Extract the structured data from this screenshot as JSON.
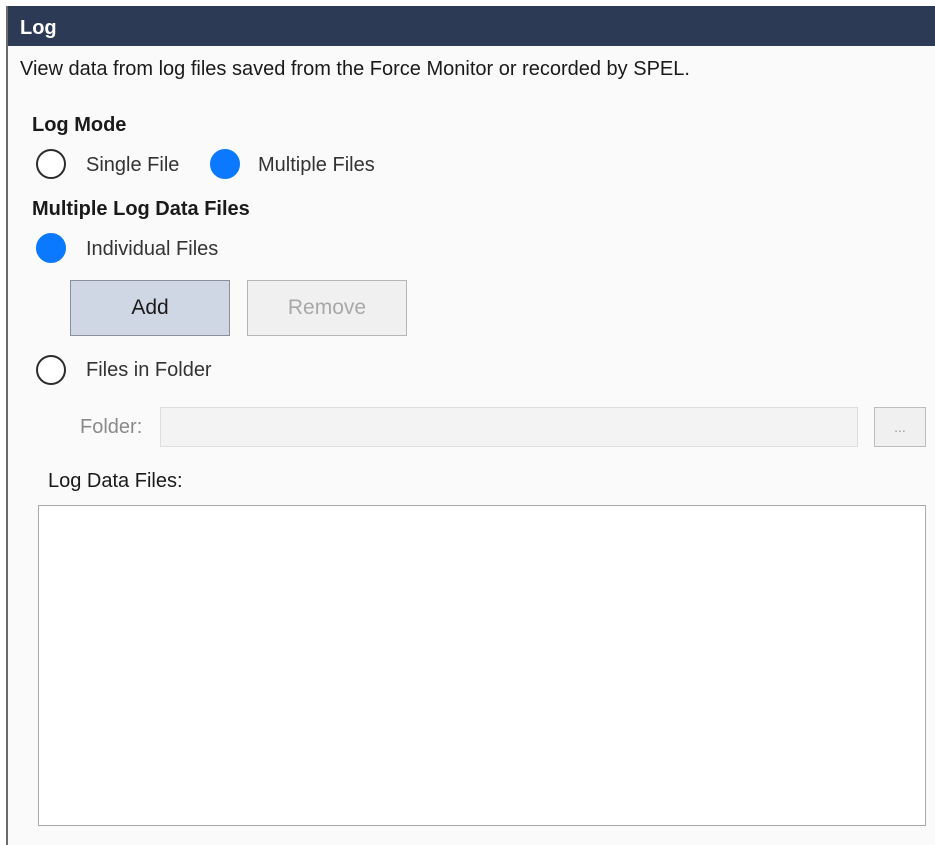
{
  "panel": {
    "title": "Log",
    "description": "View data from log files saved from the Force Monitor or recorded by SPEL."
  },
  "log_mode": {
    "heading": "Log Mode",
    "options": [
      {
        "label": "Single File",
        "selected": false
      },
      {
        "label": "Multiple Files",
        "selected": true
      }
    ]
  },
  "multiple_files": {
    "heading": "Multiple Log Data Files",
    "individual_label": "Individual Files",
    "individual_selected": true,
    "add_label": "Add",
    "remove_label": "Remove",
    "folder_option_label": "Files in Folder",
    "folder_option_selected": false,
    "folder_field_label": "Folder:",
    "folder_value": "",
    "browse_label": "..."
  },
  "log_data_files": {
    "label": "Log Data Files:",
    "items": []
  },
  "colors": {
    "title_bar": "#2d3a55",
    "radio_selected": "#0a78ff",
    "add_button": "#cfd6e4"
  }
}
